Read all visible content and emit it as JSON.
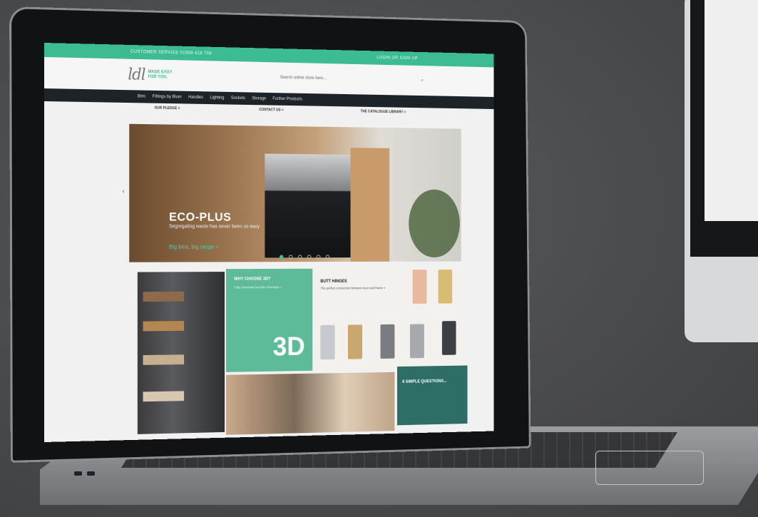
{
  "topbar": {
    "left": "CUSTOMER SERVICE 01908 418 708",
    "right": "LOGIN  OR  SIGN UP"
  },
  "header": {
    "logo_mark": "ldl",
    "logo_line1": "MADE EASY",
    "logo_line2": "FOR YOU.",
    "search_placeholder": "Search online store here..."
  },
  "nav": [
    "Bins",
    "Fittings by Blum",
    "Handles",
    "Lighting",
    "Sockets",
    "Storage",
    "Further Products"
  ],
  "promo": [
    "OUR PLEDGE >",
    "CONTACT US >",
    "THE CATALOGUE LIBRARY >"
  ],
  "hero": {
    "title": "ECO-PLUS",
    "subtitle": "Segregating waste has never been so easy",
    "link": "Big bins, big range >"
  },
  "tiles": {
    "threed": {
      "heading": "WHY CHOOSE 3D?",
      "sub": "Fully download beautiful drawings >",
      "big": "3D"
    },
    "hinges": {
      "heading": "BUTT HINGES",
      "sub": "The perfect connection between door and frame >"
    },
    "questions": {
      "heading": "6 SIMPLE QUESTIONS..."
    }
  },
  "colors": {
    "accent": "#3dbb93",
    "nav": "#1e2328",
    "teal": "#2f6e67"
  }
}
